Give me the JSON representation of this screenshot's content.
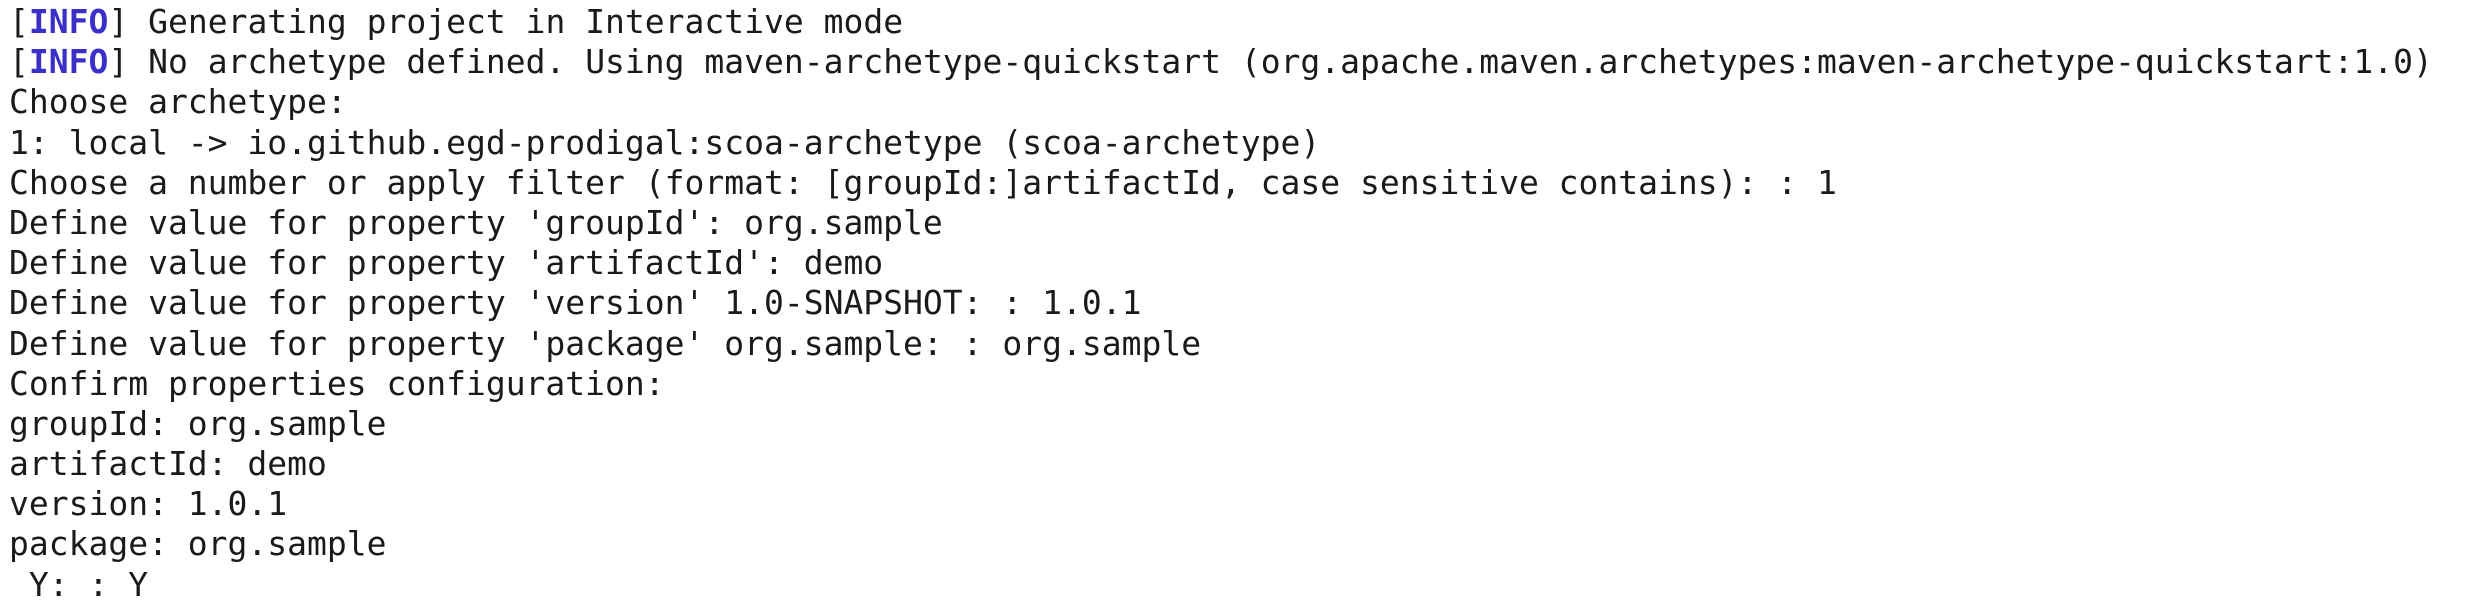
{
  "terminal": {
    "info_lines": [
      {
        "tag": "INFO",
        "message": " Generating project in Interactive mode"
      },
      {
        "tag": "INFO",
        "message": " No archetype defined. Using maven-archetype-quickstart (org.apache.maven.archetypes:maven-archetype-quickstart:1.0)"
      }
    ],
    "lines": [
      "Choose archetype:",
      "1: local -> io.github.egd-prodigal:scoa-archetype (scoa-archetype)",
      "Choose a number or apply filter (format: [groupId:]artifactId, case sensitive contains): : 1",
      "Define value for property 'groupId': org.sample",
      "Define value for property 'artifactId': demo",
      "Define value for property 'version' 1.0-SNAPSHOT: : 1.0.1",
      "Define value for property 'package' org.sample: : org.sample",
      "Confirm properties configuration:",
      "groupId: org.sample",
      "artifactId: demo",
      "version: 1.0.1",
      "package: org.sample",
      " Y: : Y"
    ]
  },
  "colors": {
    "background": "#ffffff",
    "text": "#1a1a1a",
    "info_tag": "#3b2fc9"
  }
}
